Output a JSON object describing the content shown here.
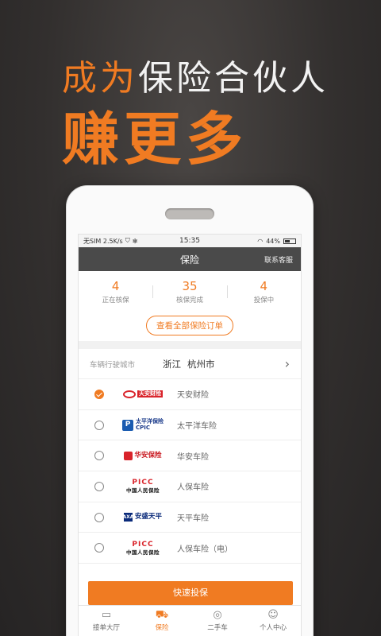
{
  "promo": {
    "line1_accent": "成为",
    "line1_rest": "保险合伙人",
    "line2": "赚更多"
  },
  "status_bar": {
    "carrier": "无SIM 2.5K/s",
    "time": "15:35",
    "battery": "44%"
  },
  "nav": {
    "title": "保险",
    "right_action": "联系客服"
  },
  "stats": [
    {
      "value": "4",
      "label": "正在核保"
    },
    {
      "value": "35",
      "label": "核保完成"
    },
    {
      "value": "4",
      "label": "投保中"
    }
  ],
  "orders_button": "查看全部保险订单",
  "city": {
    "label": "车辆行驶城市",
    "province": "浙江",
    "city": "杭州市"
  },
  "insurers": [
    {
      "name": "天安财险",
      "logo_text": "天安财险",
      "checked": true
    },
    {
      "name": "太平洋车险",
      "logo_text": "太平洋保险",
      "logo_sub": "CPIC",
      "checked": false
    },
    {
      "name": "华安车险",
      "logo_text": "华安保险",
      "checked": false
    },
    {
      "name": "人保车险",
      "logo_top": "PICC",
      "logo_bottom": "中国人民保险",
      "checked": false
    },
    {
      "name": "天平车险",
      "logo_text": "安盛天平",
      "logo_mark": "AXA",
      "checked": false
    },
    {
      "name": "人保车险（电）",
      "logo_top": "PICC",
      "logo_bottom": "中国人民保险",
      "checked": false
    }
  ],
  "submit_button": "快速投保",
  "tabs": [
    {
      "label": "接单大厅",
      "icon": "chat-icon",
      "active": false
    },
    {
      "label": "保险",
      "icon": "car-icon",
      "active": true
    },
    {
      "label": "二手车",
      "icon": "used-car-icon",
      "active": false
    },
    {
      "label": "个人中心",
      "icon": "person-icon",
      "active": false
    }
  ],
  "colors": {
    "accent": "#f07b22",
    "navbar": "#4a4a4a"
  }
}
